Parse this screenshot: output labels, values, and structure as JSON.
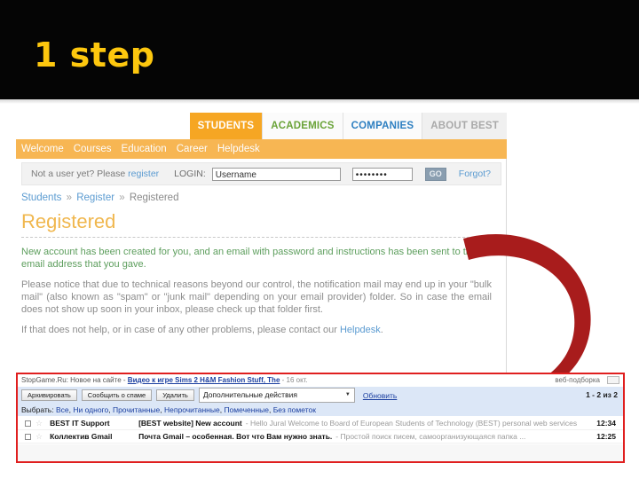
{
  "slide": {
    "title": "1 step",
    "title_color": "#fdc70e",
    "band_color": "#050505"
  },
  "site": {
    "tabs": [
      {
        "label": "STUDENTS",
        "state": "active"
      },
      {
        "label": "ACADEMICS",
        "state": "green"
      },
      {
        "label": "COMPANIES",
        "state": "blue"
      },
      {
        "label": "ABOUT BEST",
        "state": "muted"
      }
    ],
    "subnav": [
      "Welcome",
      "Courses",
      "Education",
      "Career",
      "Helpdesk"
    ],
    "login": {
      "greet_prefix": "Not a user yet? Please ",
      "register_link": "register",
      "login_label": "LOGIN:",
      "username_value": "Username",
      "username_placeholder": "Username",
      "password_value": "••••••••",
      "go_label": "GO",
      "forgot_label": "Forgot?"
    },
    "breadcrumb": {
      "first": "Students",
      "second": "Register",
      "current": "Registered",
      "separator": "»"
    },
    "heading": "Registered",
    "body": {
      "success": "New account has been created for you, and an email with password and instructions has been sent to the email address that you gave.",
      "notice": "Please notice that due to technical reasons beyond our control, the notification mail may end up in your \"bulk mail\" (also known as \"spam\" or \"junk mail\" depending on your email provider) folder. So in case the email does not show up soon in your inbox, please check up that folder first.",
      "tail_prefix": "If that does not help, or in case of any other problems, please contact our ",
      "tail_link": "Helpdesk",
      "tail_suffix": "."
    }
  },
  "annotation": {
    "arrow_color": "#a81c1c",
    "highlight_border_color": "#e01f1f"
  },
  "mail": {
    "ad": {
      "prefix": "StopGame.Ru: Новое на сайте - ",
      "link": "Видео к игре Sims 2 Н&M Fashion Stuff, The",
      "suffix": " - 16 окт.",
      "web_pick": "веб-подборка"
    },
    "toolbar": {
      "archive": "Архивировать",
      "spam": "Сообщить о спаме",
      "delete": "Удалить",
      "more_actions": "Дополнительные действия",
      "caret": "▼",
      "refresh": "Обновить",
      "count": "1 - 2 из 2"
    },
    "select_row": {
      "label": "Выбрать:",
      "options": [
        "Все",
        "Ни одного",
        "Прочитанные",
        "Непрочитанные",
        "Помеченные",
        "Без пометок"
      ]
    },
    "rows": [
      {
        "sender": "BEST IT Support",
        "subject": "[BEST website] New account",
        "snippet": "- Hello Jural Welcome to Board of European Students of Technology (BEST) personal web services",
        "time": "12:34",
        "star": "☆"
      },
      {
        "sender": "Коллектив Gmail",
        "subject": "Почта Gmail – особенная. Вот что Вам нужно знать.",
        "snippet": "- Простой поиск писем, самоорганизующаяся папка ...",
        "time": "12:25",
        "star": "☆"
      }
    ]
  }
}
